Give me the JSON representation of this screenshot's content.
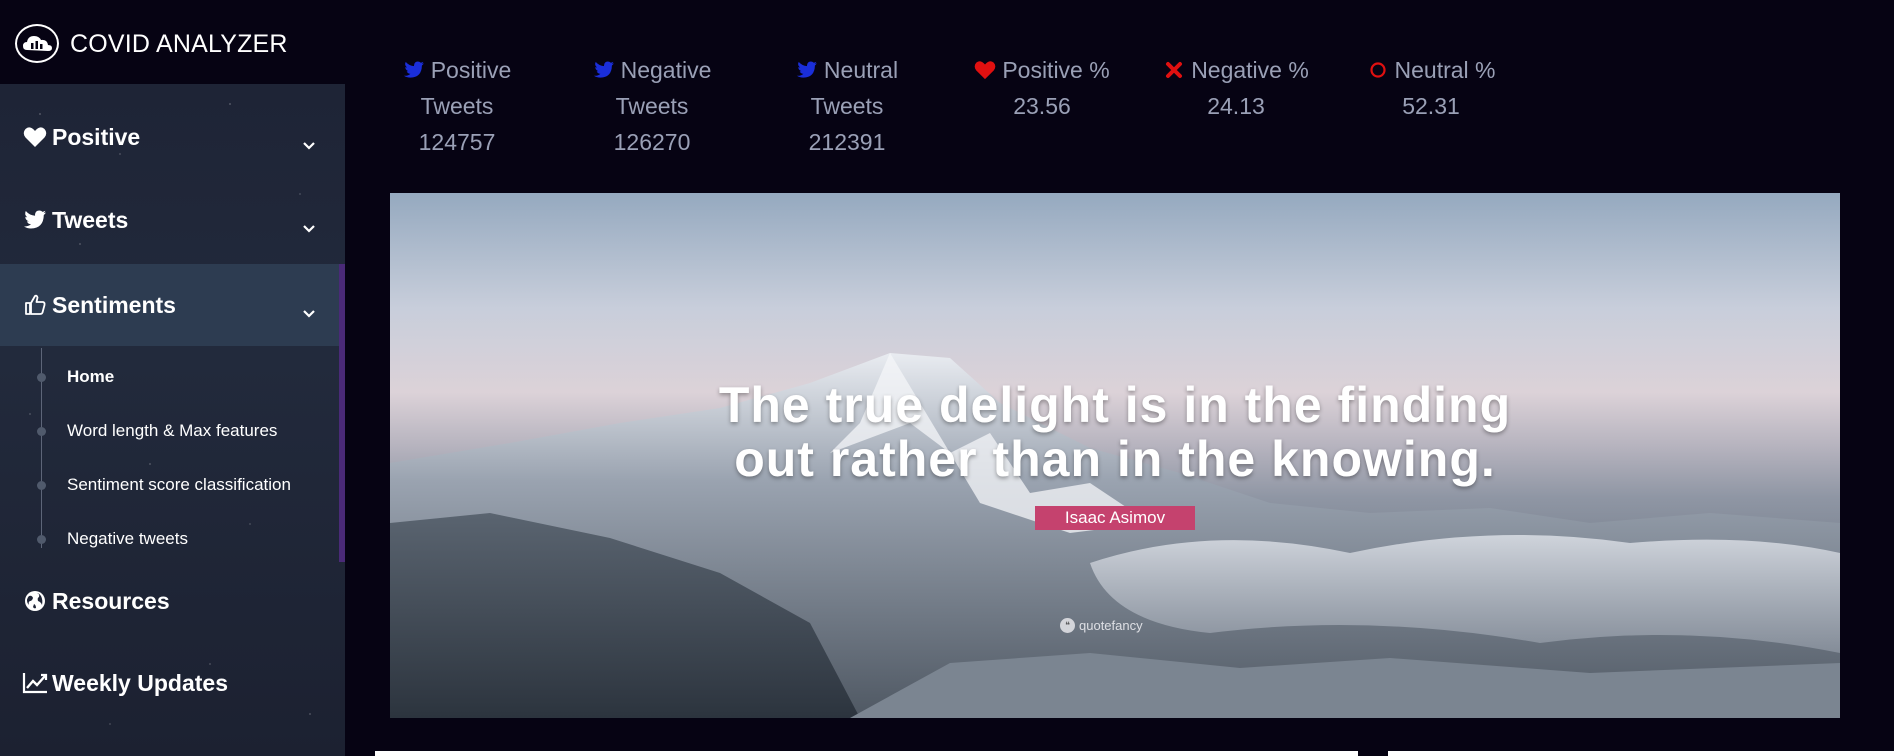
{
  "brand": {
    "title": "COVID ANALYZER"
  },
  "sidebar": {
    "items": [
      {
        "label": "Positive",
        "icon": "heart-icon"
      },
      {
        "label": "Tweets",
        "icon": "twitter-icon"
      },
      {
        "label": "Sentiments",
        "icon": "thumbs-up-icon",
        "active": true
      },
      {
        "label": "Resources",
        "icon": "globe-icon"
      },
      {
        "label": "Weekly Updates",
        "icon": "line-chart-icon"
      }
    ],
    "submenu": [
      {
        "label": "Home",
        "current": true
      },
      {
        "label": "Word length & Max features"
      },
      {
        "label": "Sentiment score classification"
      },
      {
        "label": "Negative tweets"
      }
    ]
  },
  "stats": [
    {
      "line1": "Positive",
      "line2": "Tweets",
      "value": "124757",
      "icon": "twitter-icon",
      "icon_color": "#1a2ed9"
    },
    {
      "line1": "Negative",
      "line2": "Tweets",
      "value": "126270",
      "icon": "twitter-icon",
      "icon_color": "#1a2ed9"
    },
    {
      "line1": "Neutral",
      "line2": "Tweets",
      "value": "212391",
      "icon": "twitter-icon",
      "icon_color": "#1a2ed9"
    },
    {
      "line1": "Positive %",
      "line2": "23.56",
      "icon": "heart-icon",
      "icon_color": "#e01010"
    },
    {
      "line1": "Negative %",
      "line2": "24.13",
      "icon": "x-icon",
      "icon_color": "#e01010"
    },
    {
      "line1": "Neutral %",
      "line2": "52.31",
      "icon": "circle-icon",
      "icon_color": "#e01010"
    }
  ],
  "banner": {
    "quote_line1": "The true delight is in the finding",
    "quote_line2": "out rather than in the knowing.",
    "author": "Isaac Asimov",
    "watermark": "quotefancy"
  },
  "colors": {
    "background": "#060313",
    "sidebar_active": "#2d3c51",
    "accent_bar": "#4a2a78",
    "stat_text": "#9aa0b6",
    "author_badge": "#c5426e"
  }
}
